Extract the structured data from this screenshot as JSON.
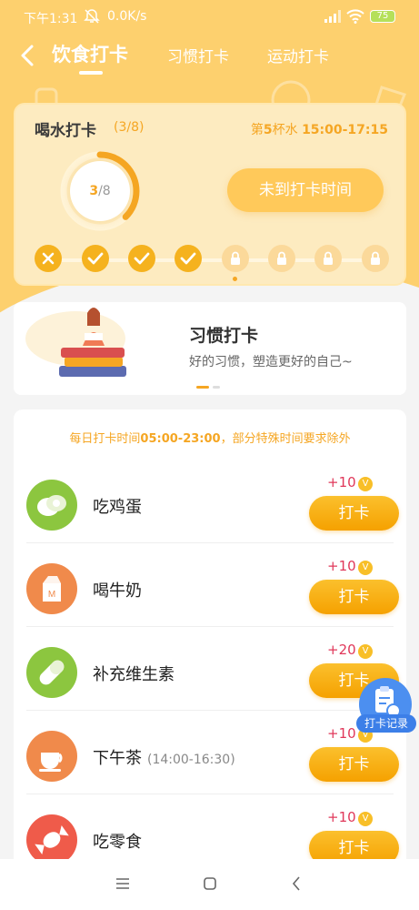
{
  "status_bar": {
    "time": "下午1:31",
    "speed": "0.0K/s",
    "battery": "75"
  },
  "nav": {
    "tabs": [
      {
        "label": "饮食打卡",
        "active": true
      },
      {
        "label": "习惯打卡",
        "active": false
      },
      {
        "label": "运动打卡",
        "active": false
      }
    ]
  },
  "water": {
    "title": "喝水打卡",
    "count": "(3/8)",
    "cup_prefix": "第",
    "cup_number": "5",
    "cup_suffix": "杯水",
    "cup_time": "15:00-17:15",
    "progress_done": "3",
    "progress_total": "/8",
    "progress_value": 3,
    "progress_max": 8,
    "button": "未到打卡时间",
    "slots": [
      "missed",
      "done",
      "done",
      "done",
      "locked",
      "locked",
      "locked",
      "locked"
    ]
  },
  "banner": {
    "title": "习惯打卡",
    "subtitle": "好的习惯，塑造更好的自己~"
  },
  "list": {
    "tip_prefix": "每日打卡时间",
    "tip_time": "05:00-23:00",
    "tip_suffix": "，部分特殊时间要求除外",
    "items": [
      {
        "name": "吃鸡蛋",
        "sub": "",
        "points": "+10",
        "button": "打卡",
        "icon": "egg-icon",
        "color": "#8cc63f"
      },
      {
        "name": "喝牛奶",
        "sub": "",
        "points": "+10",
        "button": "打卡",
        "icon": "milk-icon",
        "color": "#f08a4b"
      },
      {
        "name": "补充维生素",
        "sub": "",
        "points": "+20",
        "button": "打卡",
        "icon": "pill-icon",
        "color": "#8cc63f"
      },
      {
        "name": "下午茶",
        "sub": "(14:00-16:30)",
        "points": "+10",
        "button": "打卡",
        "icon": "teacup-icon",
        "color": "#f08a4b"
      },
      {
        "name": "吃零食",
        "sub": "",
        "points": "+10",
        "button": "打卡",
        "icon": "candy-icon",
        "color": "#ef5b4a"
      }
    ]
  },
  "floating": {
    "label": "打卡记录"
  },
  "coin_symbol": "V"
}
